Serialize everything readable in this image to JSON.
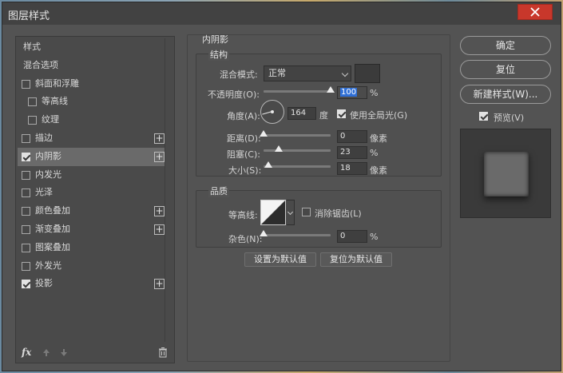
{
  "window": {
    "title": "图层样式"
  },
  "left_panel": {
    "items": [
      {
        "label": "样式",
        "checkbox": false
      },
      {
        "label": "混合选项",
        "checkbox": false
      },
      {
        "label": "斜面和浮雕",
        "checkbox": true,
        "checked": false
      },
      {
        "label": "等高线",
        "checkbox": true,
        "checked": false,
        "indent": true
      },
      {
        "label": "纹理",
        "checkbox": true,
        "checked": false,
        "indent": true
      },
      {
        "label": "描边",
        "checkbox": true,
        "checked": false,
        "plus": true
      },
      {
        "label": "内阴影",
        "checkbox": true,
        "checked": true,
        "plus": true,
        "selected": true
      },
      {
        "label": "内发光",
        "checkbox": true,
        "checked": false
      },
      {
        "label": "光泽",
        "checkbox": true,
        "checked": false
      },
      {
        "label": "颜色叠加",
        "checkbox": true,
        "checked": false,
        "plus": true
      },
      {
        "label": "渐变叠加",
        "checkbox": true,
        "checked": false,
        "plus": true
      },
      {
        "label": "图案叠加",
        "checkbox": true,
        "checked": false
      },
      {
        "label": "外发光",
        "checkbox": true,
        "checked": false
      },
      {
        "label": "投影",
        "checkbox": true,
        "checked": true,
        "plus": true
      }
    ],
    "fx_label": "fx"
  },
  "inner_shadow": {
    "section_title": "内阴影",
    "structure": {
      "title": "结构",
      "blend_mode_label": "混合模式:",
      "blend_mode_value": "正常",
      "opacity_label": "不透明度(O):",
      "opacity_value": "100",
      "opacity_unit": "%",
      "opacity_level": 1.0,
      "angle_label": "角度(A):",
      "angle_value": "164",
      "angle_unit": "度",
      "global_light_label": "使用全局光(G)",
      "global_light_checked": true,
      "distance_label": "距离(D):",
      "distance_value": "0",
      "distance_unit": "像素",
      "choke_label": "阻塞(C):",
      "choke_value": "23",
      "choke_unit": "%",
      "size_label": "大小(S):",
      "size_value": "18",
      "size_unit": "像素"
    },
    "quality": {
      "title": "品质",
      "contour_label": "等高线:",
      "anti_alias_label": "消除锯齿(L)",
      "anti_alias_checked": false,
      "noise_label": "杂色(N):",
      "noise_value": "0",
      "noise_unit": "%"
    },
    "set_default_label": "设置为默认值",
    "reset_default_label": "复位为默认值"
  },
  "right_panel": {
    "ok_label": "确定",
    "reset_label": "复位",
    "new_style_label": "新建样式(W)...",
    "preview_label": "预览(V)",
    "preview_checked": true
  }
}
